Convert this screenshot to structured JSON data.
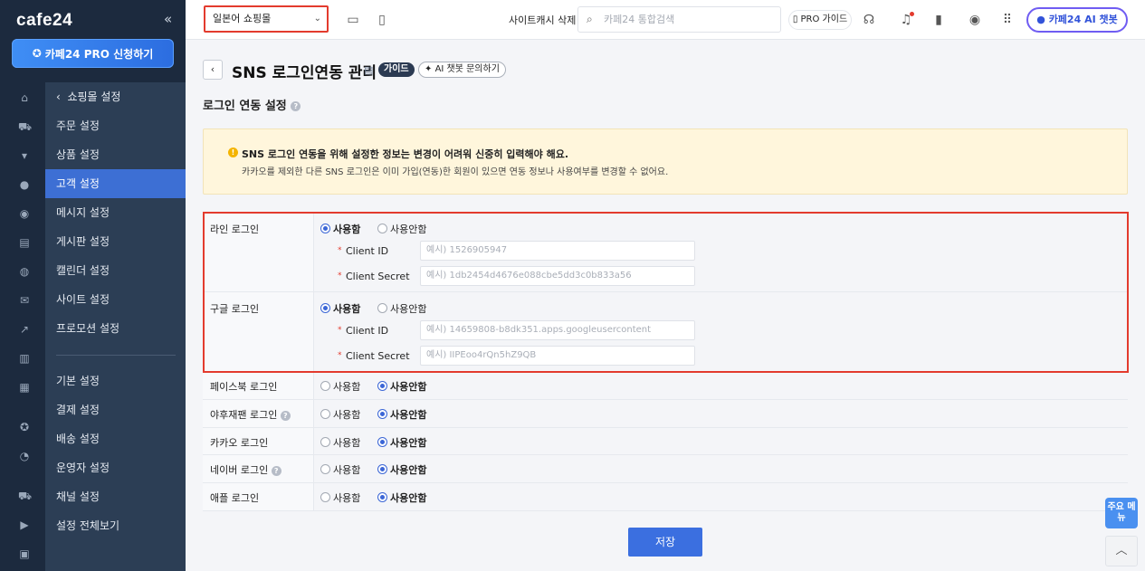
{
  "sidebar": {
    "logo": "cafe24",
    "collapse_icon": "«",
    "pro_button": "카페24 PRO 신청하기",
    "items": [
      {
        "label": "쇼핑몰 설정"
      },
      {
        "label": "주문 설정"
      },
      {
        "label": "상품 설정"
      },
      {
        "label": "고객 설정"
      },
      {
        "label": "메시지 설정"
      },
      {
        "label": "게시판 설정"
      },
      {
        "label": "캘린더 설정"
      },
      {
        "label": "사이트 설정"
      },
      {
        "label": "프로모션 설정"
      },
      {
        "label": "기본 설정"
      },
      {
        "label": "결제 설정"
      },
      {
        "label": "배송 설정"
      },
      {
        "label": "운영자 설정"
      },
      {
        "label": "채널 설정"
      },
      {
        "label": "설정 전체보기"
      }
    ],
    "active_item": "고객 설정",
    "rail_icons": [
      "home-icon",
      "cart-icon",
      "shirt-icon",
      "user-icon",
      "chat-icon",
      "board-icon",
      "palette-icon",
      "mail-icon",
      "chart-icon",
      "stats-icon",
      "report-icon",
      "badge-icon",
      "globe-icon",
      "truck-icon",
      "youtube-icon",
      "bag-icon"
    ]
  },
  "topbar": {
    "shop_select": "일본어 쇼핑몰",
    "cache_delete": "사이트캐시 삭제",
    "search_placeholder": "카페24 통합검색",
    "pro_guide": "PRO 가이드",
    "ai_chatbot": "카페24 AI 챗봇"
  },
  "header": {
    "title": "SNS 로그인연동 관리",
    "guide_badge": "가이드",
    "ai_inquiry": "AI 챗봇 문의하기",
    "section_title": "로그인 연동 설정"
  },
  "notice": {
    "line1": "SNS 로그인 연동을 위해 설정한 정보는 변경이 어려워 신중히 입력해야 해요.",
    "line2": "카카오를 제외한 다른 SNS 로그인은 이미 가입(연동)한 회원이 있으면 연동 정보나 사용여부를 변경할 수 없어요."
  },
  "options": {
    "use": "사용함",
    "not_use": "사용안함"
  },
  "fields": {
    "client_id": "Client ID",
    "client_secret": "Client Secret",
    "required_mark": "*"
  },
  "rows": {
    "line": {
      "label": "라인 로그인",
      "selected": "사용함",
      "client_id_placeholder": "예시) 1526905947",
      "client_secret_placeholder": "예시) 1db2454d4676e088cbe5dd3c0b833a56"
    },
    "google": {
      "label": "구글 로그인",
      "selected": "사용함",
      "client_id_placeholder": "예시) 14659808-b8dk351.apps.googleusercontent",
      "client_secret_placeholder": "예시) IIPEoo4rQn5hZ9QB"
    },
    "facebook": {
      "label": "페이스북 로그인",
      "selected": "사용안함"
    },
    "yahoo": {
      "label": "야후재팬 로그인",
      "selected": "사용안함"
    },
    "kakao": {
      "label": "카카오 로그인",
      "selected": "사용안함"
    },
    "naver": {
      "label": "네이버 로그인",
      "selected": "사용안함"
    },
    "apple": {
      "label": "애플 로그인",
      "selected": "사용안함"
    }
  },
  "actions": {
    "save": "저장",
    "key_menu": "주요 메뉴"
  },
  "colors": {
    "highlight_border": "#e33b2e",
    "primary": "#3b6fe0",
    "sidebar": "#2c3e55"
  }
}
